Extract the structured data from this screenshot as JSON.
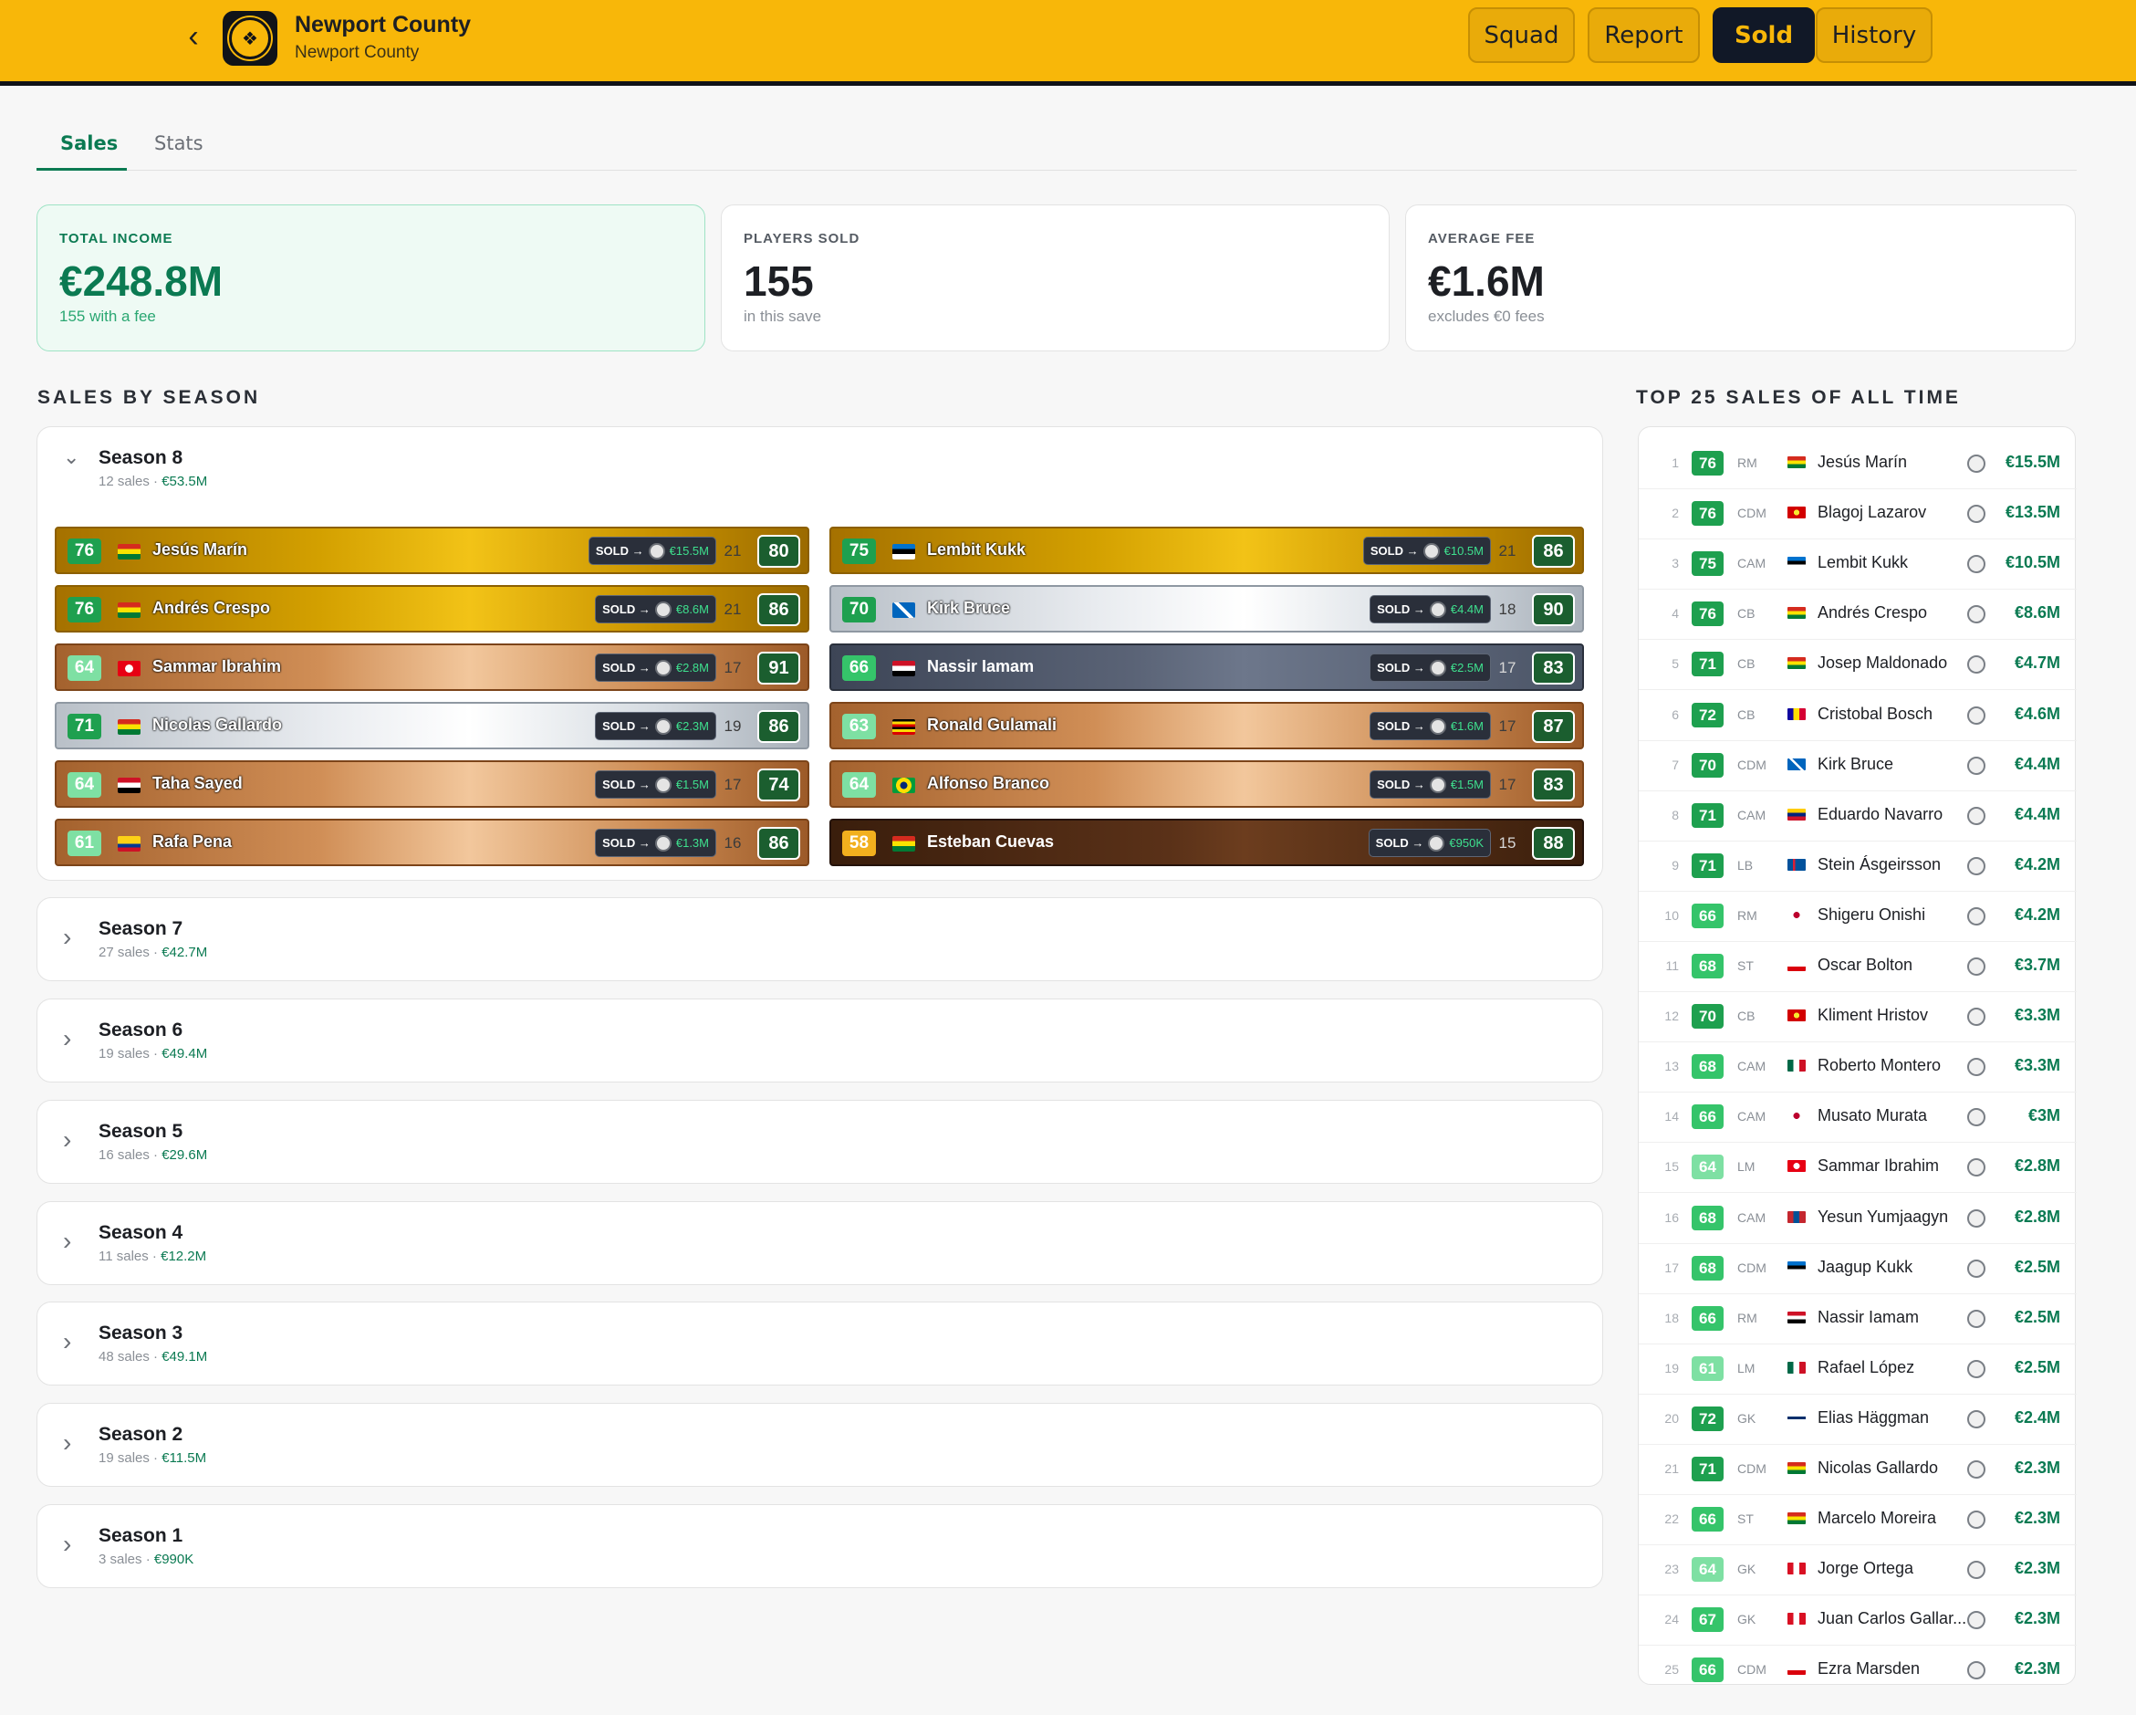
{
  "header": {
    "club_name": "Newport County",
    "club_sub": "Newport County",
    "nav": [
      "Squad",
      "Report",
      "Sold",
      "History"
    ],
    "active_nav": "Sold"
  },
  "tabs": [
    "Sales",
    "Stats"
  ],
  "stats": {
    "total_income": {
      "label": "TOTAL INCOME",
      "value": "€248.8M",
      "sub": "155 with a fee"
    },
    "players_sold": {
      "label": "PLAYERS SOLD",
      "value": "155",
      "sub": "in this save"
    },
    "average_fee": {
      "label": "AVERAGE FEE",
      "value": "€1.6M",
      "sub": "excludes €0 fees"
    }
  },
  "sections": {
    "by_season": "SALES BY SEASON",
    "top25": "TOP 25 SALES OF ALL TIME"
  },
  "sold_label": "SOLD →",
  "seasons": [
    {
      "name": "Season 8",
      "count": "12 sales",
      "total": "€53.5M",
      "expanded": true
    },
    {
      "name": "Season 7",
      "count": "27 sales",
      "total": "€42.7M"
    },
    {
      "name": "Season 6",
      "count": "19 sales",
      "total": "€49.4M"
    },
    {
      "name": "Season 5",
      "count": "16 sales",
      "total": "€29.6M"
    },
    {
      "name": "Season 4",
      "count": "11 sales",
      "total": "€12.2M"
    },
    {
      "name": "Season 3",
      "count": "48 sales",
      "total": "€49.1M"
    },
    {
      "name": "Season 2",
      "count": "19 sales",
      "total": "€11.5M"
    },
    {
      "name": "Season 1",
      "count": "3 sales",
      "total": "€990K"
    }
  ],
  "season8_players": [
    {
      "ovr": "76",
      "name": "Jesús Marín",
      "fee": "€15.5M",
      "age": "21",
      "pot": "80",
      "tier": "gold",
      "flag": "bolivia"
    },
    {
      "ovr": "75",
      "name": "Lembit Kukk",
      "fee": "€10.5M",
      "age": "21",
      "pot": "86",
      "tier": "gold",
      "flag": "estonia"
    },
    {
      "ovr": "76",
      "name": "Andrés Crespo",
      "fee": "€8.6M",
      "age": "21",
      "pot": "86",
      "tier": "gold",
      "flag": "bolivia"
    },
    {
      "ovr": "70",
      "name": "Kirk Bruce",
      "fee": "€4.4M",
      "age": "18",
      "pot": "90",
      "tier": "silver",
      "flag": "scotland"
    },
    {
      "ovr": "64",
      "name": "Sammar Ibrahim",
      "fee": "€2.8M",
      "age": "17",
      "pot": "91",
      "tier": "bronze",
      "flag": "tunisia"
    },
    {
      "ovr": "66",
      "name": "Nassir Iamam",
      "fee": "€2.5M",
      "age": "17",
      "pot": "83",
      "tier": "navy",
      "flag": "egypt"
    },
    {
      "ovr": "71",
      "name": "Nicolas Gallardo",
      "fee": "€2.3M",
      "age": "19",
      "pot": "86",
      "tier": "silver",
      "flag": "bolivia"
    },
    {
      "ovr": "63",
      "name": "Ronald Gulamali",
      "fee": "€1.6M",
      "age": "17",
      "pot": "87",
      "tier": "bronze",
      "flag": "uganda"
    },
    {
      "ovr": "64",
      "name": "Taha Sayed",
      "fee": "€1.5M",
      "age": "17",
      "pot": "74",
      "tier": "bronze",
      "flag": "egypt"
    },
    {
      "ovr": "64",
      "name": "Alfonso Branco",
      "fee": "€1.5M",
      "age": "17",
      "pot": "83",
      "tier": "bronze",
      "flag": "brazil"
    },
    {
      "ovr": "61",
      "name": "Rafa Pena",
      "fee": "€1.3M",
      "age": "16",
      "pot": "86",
      "tier": "bronze",
      "flag": "colombia"
    },
    {
      "ovr": "58",
      "name": "Esteban Cuevas",
      "fee": "€950K",
      "age": "15",
      "pot": "88",
      "tier": "dark",
      "flag": "bolivia"
    }
  ],
  "top25": [
    {
      "rank": "1",
      "ovr": "76",
      "pos": "RM",
      "name": "Jesús Marín",
      "fee": "€15.5M",
      "flag": "bolivia"
    },
    {
      "rank": "2",
      "ovr": "76",
      "pos": "CDM",
      "name": "Blagoj Lazarov",
      "fee": "€13.5M",
      "flag": "macedonia"
    },
    {
      "rank": "3",
      "ovr": "75",
      "pos": "CAM",
      "name": "Lembit Kukk",
      "fee": "€10.5M",
      "flag": "estonia"
    },
    {
      "rank": "4",
      "ovr": "76",
      "pos": "CB",
      "name": "Andrés Crespo",
      "fee": "€8.6M",
      "flag": "bolivia"
    },
    {
      "rank": "5",
      "ovr": "71",
      "pos": "CB",
      "name": "Josep Maldonado",
      "fee": "€4.7M",
      "flag": "bolivia"
    },
    {
      "rank": "6",
      "ovr": "72",
      "pos": "CB",
      "name": "Cristobal Bosch",
      "fee": "€4.6M",
      "flag": "andorra"
    },
    {
      "rank": "7",
      "ovr": "70",
      "pos": "CDM",
      "name": "Kirk Bruce",
      "fee": "€4.4M",
      "flag": "scotland"
    },
    {
      "rank": "8",
      "ovr": "71",
      "pos": "CAM",
      "name": "Eduardo Navarro",
      "fee": "€4.4M",
      "flag": "venezuela"
    },
    {
      "rank": "9",
      "ovr": "71",
      "pos": "LB",
      "name": "Stein Ásgeirsson",
      "fee": "€4.2M",
      "flag": "iceland"
    },
    {
      "rank": "10",
      "ovr": "66",
      "pos": "RM",
      "name": "Shigeru Onishi",
      "fee": "€4.2M",
      "flag": "japan"
    },
    {
      "rank": "11",
      "ovr": "68",
      "pos": "ST",
      "name": "Oscar Bolton",
      "fee": "€3.7M",
      "flag": "gibraltar"
    },
    {
      "rank": "12",
      "ovr": "70",
      "pos": "CB",
      "name": "Kliment Hristov",
      "fee": "€3.3M",
      "flag": "macedonia"
    },
    {
      "rank": "13",
      "ovr": "68",
      "pos": "CAM",
      "name": "Roberto Montero",
      "fee": "€3.3M",
      "flag": "mexico"
    },
    {
      "rank": "14",
      "ovr": "66",
      "pos": "CAM",
      "name": "Musato Murata",
      "fee": "€3M",
      "flag": "japan"
    },
    {
      "rank": "15",
      "ovr": "64",
      "pos": "LM",
      "name": "Sammar Ibrahim",
      "fee": "€2.8M",
      "flag": "tunisia"
    },
    {
      "rank": "16",
      "ovr": "68",
      "pos": "CAM",
      "name": "Yesun Yumjaagyn",
      "fee": "€2.8M",
      "flag": "mongolia"
    },
    {
      "rank": "17",
      "ovr": "68",
      "pos": "CDM",
      "name": "Jaagup Kukk",
      "fee": "€2.5M",
      "flag": "estonia"
    },
    {
      "rank": "18",
      "ovr": "66",
      "pos": "RM",
      "name": "Nassir Iamam",
      "fee": "€2.5M",
      "flag": "egypt"
    },
    {
      "rank": "19",
      "ovr": "61",
      "pos": "LM",
      "name": "Rafael López",
      "fee": "€2.5M",
      "flag": "mexico"
    },
    {
      "rank": "20",
      "ovr": "72",
      "pos": "GK",
      "name": "Elias Häggman",
      "fee": "€2.4M",
      "flag": "finland"
    },
    {
      "rank": "21",
      "ovr": "71",
      "pos": "CDM",
      "name": "Nicolas Gallardo",
      "fee": "€2.3M",
      "flag": "bolivia"
    },
    {
      "rank": "22",
      "ovr": "66",
      "pos": "ST",
      "name": "Marcelo Moreira",
      "fee": "€2.3M",
      "flag": "bolivia"
    },
    {
      "rank": "23",
      "ovr": "64",
      "pos": "GK",
      "name": "Jorge Ortega",
      "fee": "€2.3M",
      "flag": "peru"
    },
    {
      "rank": "24",
      "ovr": "67",
      "pos": "GK",
      "name": "Juan Carlos Gallar...",
      "fee": "€2.3M",
      "flag": "peru"
    },
    {
      "rank": "25",
      "ovr": "66",
      "pos": "CDM",
      "name": "Ezra Marsden",
      "fee": "€2.3M",
      "flag": "gibraltar"
    }
  ],
  "colors": {
    "accent": "#0b7a52",
    "header": "#f8b709",
    "dark": "#111827"
  }
}
